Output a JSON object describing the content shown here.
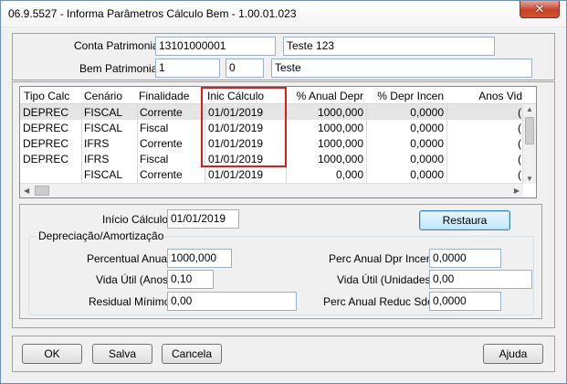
{
  "window": {
    "title": "06.9.5527 - Informa Parâmetros Cálculo Bem - 1.00.01.023",
    "close_label": "✕"
  },
  "header": {
    "conta_label": "Conta Patrimonial:",
    "conta_code": "13101000001",
    "conta_desc": "Teste 123",
    "bem_label": "Bem Patrimonial:",
    "bem_code": "1",
    "bem_seq": "0",
    "bem_desc": "Teste"
  },
  "grid": {
    "columns": [
      "Tipo Calc",
      "Cenário",
      "Finalidade",
      "Inic Cálculo",
      "% Anual Depr",
      "% Depr Incen",
      "Anos Vid"
    ],
    "rows": [
      [
        "DEPREC",
        "FISCAL",
        "Corrente",
        "01/01/2019",
        "1000,000",
        "0,0000",
        "("
      ],
      [
        "DEPREC",
        "FISCAL",
        "Fiscal",
        "01/01/2019",
        "1000,000",
        "0,0000",
        "("
      ],
      [
        "DEPREC",
        "IFRS",
        "Corrente",
        "01/01/2019",
        "1000,000",
        "0,0000",
        "("
      ],
      [
        "DEPREC",
        "IFRS",
        "Fiscal",
        "01/01/2019",
        "1000,000",
        "0,0000",
        "("
      ],
      [
        "",
        "FISCAL",
        "Corrente",
        "01/01/2019",
        "0,000",
        "0,0000",
        "("
      ]
    ]
  },
  "detail": {
    "inicio_label": "Início Cálculo:",
    "inicio_value": "01/01/2019",
    "restaura_label": "Restaura",
    "group_title": "Depreciação/Amortização",
    "percentual_label": "Percentual Anual:",
    "percentual_value": "1000,000",
    "vida_anos_label": "Vida Útil (Anos):",
    "vida_anos_value": "0,10",
    "residual_label": "Residual Mínimo:",
    "residual_value": "0,00",
    "perc_incen_label": "Perc Anual Dpr Incen:",
    "perc_incen_value": "0,0000",
    "vida_unid_label": "Vida Útil (Unidades):",
    "vida_unid_value": "0,00",
    "perc_reduc_label": "Perc Anual Reduc Sdo:",
    "perc_reduc_value": "0,0000"
  },
  "buttons": {
    "ok": "OK",
    "salva": "Salva",
    "cancela": "Cancela",
    "ajuda": "Ajuda"
  },
  "colors": {
    "highlight": "#e0191b",
    "selected_row": "#e5e5e5"
  }
}
